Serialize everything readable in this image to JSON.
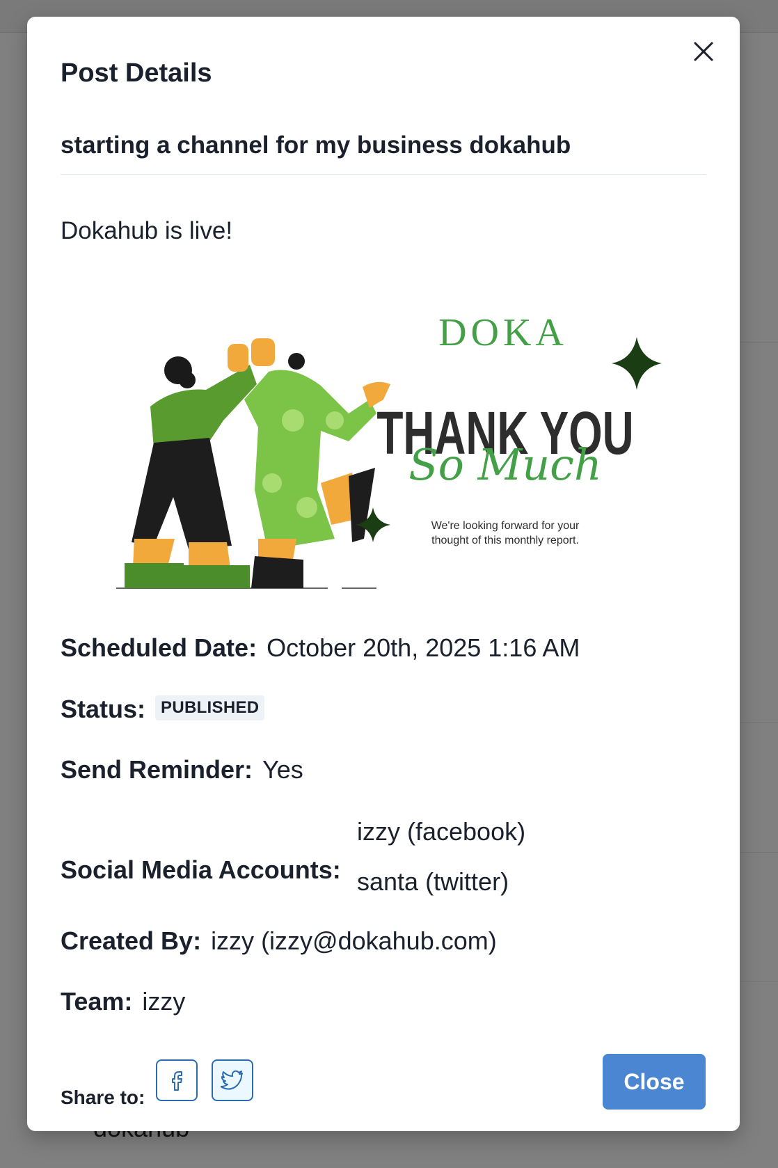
{
  "background": {
    "peek_text": "dokahub"
  },
  "modal": {
    "title": "Post Details",
    "post_title": "starting a channel for my business dokahub",
    "post_body": "Dokahub is live!",
    "image": {
      "brand": "DOKA",
      "headline": "THANK YOU",
      "script": "So Much",
      "caption_line1": "We're looking forward for your",
      "caption_line2": "thought of this monthly report.",
      "colors": {
        "green": "#43a047",
        "dark": "#2d2d2d",
        "orange": "#f2a93b",
        "star": "#1b3d14"
      }
    },
    "details": {
      "scheduled_label": "Scheduled Date:",
      "scheduled_value": "October 20th, 2025 1:16 AM",
      "status_label": "Status:",
      "status_value": "PUBLISHED",
      "reminder_label": "Send Reminder:",
      "reminder_value": "Yes",
      "accounts_label": "Social Media Accounts:",
      "accounts": [
        "izzy (facebook)",
        "santa (twitter)"
      ],
      "created_label": "Created By:",
      "created_value": "izzy (izzy@dokahub.com)",
      "team_label": "Team:",
      "team_value": "izzy"
    },
    "footer": {
      "share_label": "Share to:",
      "share_icons": [
        "facebook-icon",
        "twitter-icon"
      ],
      "close_label": "Close"
    }
  },
  "colors": {
    "accent": "#4a86d1",
    "badge_bg": "#edf2f7",
    "icon_blue": "#2b6cb0"
  }
}
